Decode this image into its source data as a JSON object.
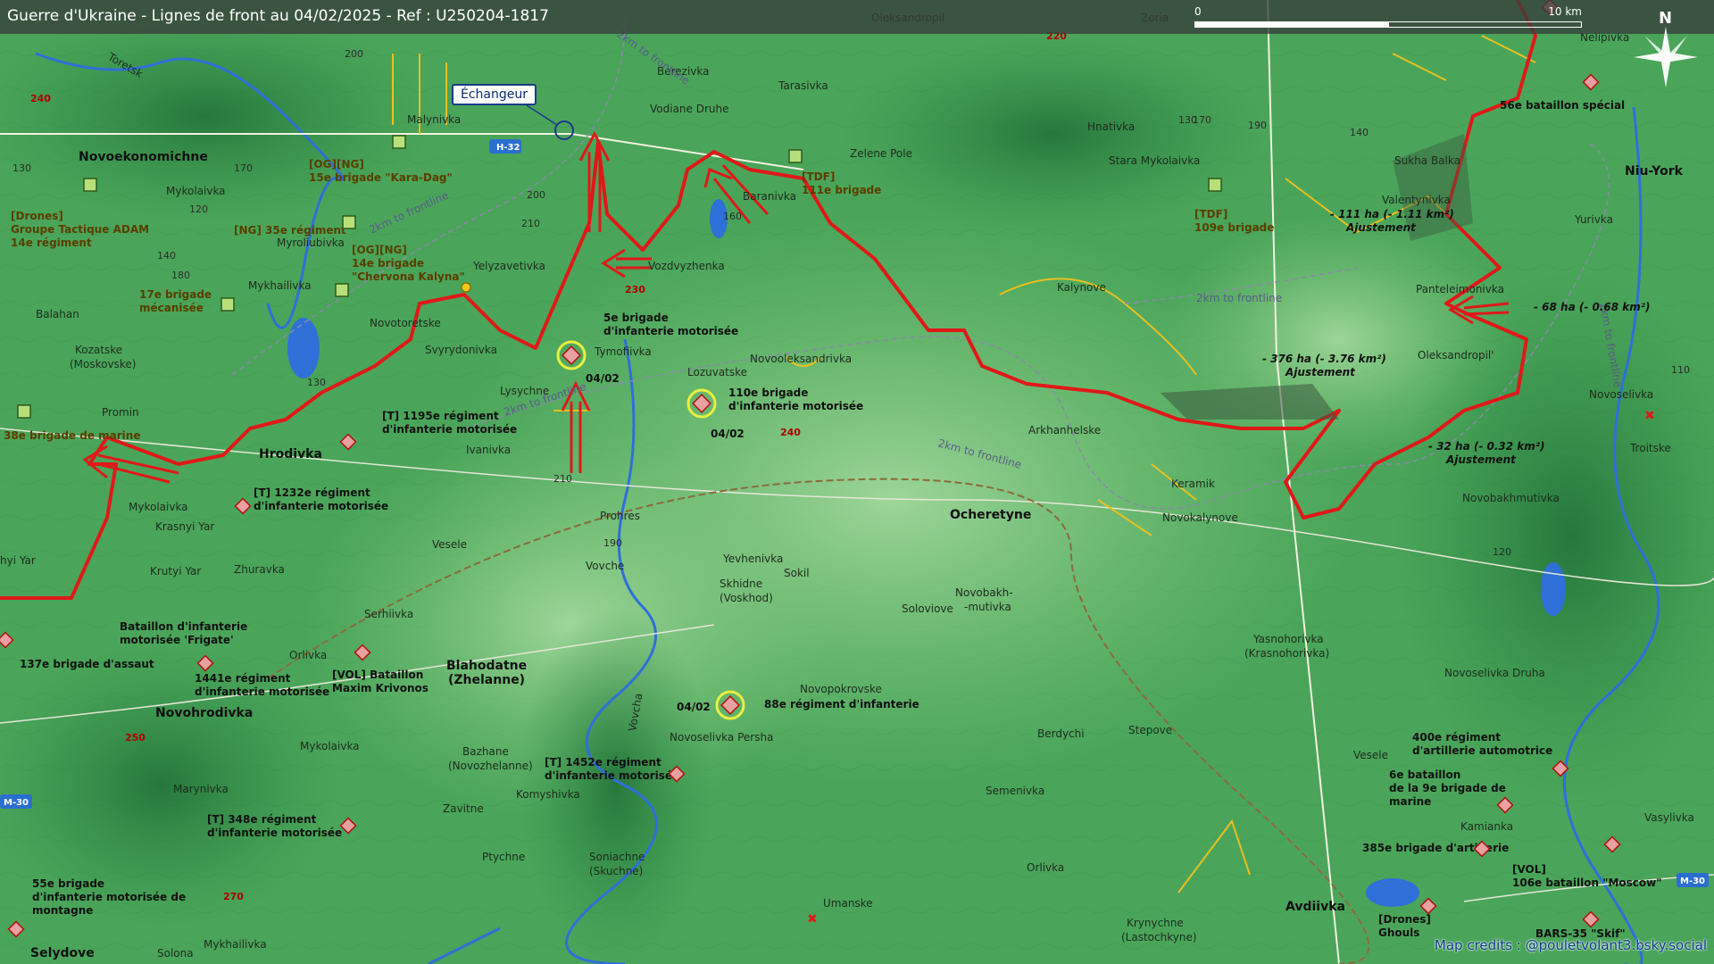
{
  "title": "Guerre d'Ukraine - Lignes de front au 04/02/2025 - Ref : U250204-1817",
  "scale": {
    "start": "0",
    "end": "10 km"
  },
  "compass": {
    "label": "N",
    "icon": "compass-rose-icon"
  },
  "credits": "Map credits : @pouletvolant3.bsky.social",
  "colors": {
    "front_line": "#e01818",
    "unit_marker": "#e8a0a0",
    "unit_marker_border": "#b01010",
    "friendly_marker": "#b8e07a",
    "highlight_ring": "#e8f040",
    "road_badge": "#2a6fd0",
    "river": "#2f6fd8",
    "yellow_trench": "#e8c020"
  },
  "callouts": {
    "echangeur": "Échangeur"
  },
  "towns": [
    "Novoekonomichne",
    "Hrodivka",
    "Novohrodivka",
    "Selydove",
    "Blahodatne",
    "(Zhelanne)",
    "Ocheretyne",
    "Avdiivka",
    "Niu-York"
  ],
  "places": [
    "Oleksandropil",
    "Zoria",
    "Nelipivka",
    "Malynivka",
    "Berezivka",
    "Vodiane Druhe",
    "Tarasivka",
    "Zelene Pole",
    "Hnativka",
    "Stara Mykolaivka",
    "Sukha Balka",
    "Mykolaivka",
    "Baranivka",
    "Valentynivka",
    "Yurivka",
    "Myroliubivka",
    "Yelyzavetivka",
    "Vozdvyzhenka",
    "Mykhailivka",
    "Kalynove",
    "Panteleimonivka",
    "Balahan",
    "Novotoretske",
    "Kozatske",
    "(Moskovske)",
    "Svyrydonivka",
    "Tymofiivka",
    "Lozuvatske",
    "Novooleksandrivka",
    "Oleksandropil'",
    "Novoselivka",
    "Lysychne",
    "Promin",
    "Arkhanhelske",
    "Ivanivka",
    "Troitske",
    "Keramik",
    "Novokalynove",
    "Mykolaivka",
    "Novobakhmutivka",
    "Krasnyi Yar",
    "Prohres",
    "Vesele",
    "Krutyi Yar",
    "Zhuravka",
    "Vovche",
    "Yevhenivka",
    "Sokil",
    "Skhidne",
    "(Voskhod)",
    "Novobakh-",
    "-mutivka",
    "Soloviove",
    "Serhiivka",
    "Orlivka",
    "Yasnohorivka",
    "(Krasnohorivka)",
    "Novoselivka Druha",
    "Novopokrovske",
    "Mykolaivka",
    "Bazhane",
    "(Novozhelanne)",
    "Novoselivka Persha",
    "Berdychi",
    "Stepove",
    "Marynivka",
    "Komyshivka",
    "Zavitne",
    "Semenivka",
    "Vesele",
    "Kamianka",
    "Vasylivka",
    "Ptychne",
    "Soniachne",
    "(Skuchne)",
    "Orlivka",
    "Umanske",
    "Krynychne",
    "(Lastochkyne)",
    "Mykhailivka",
    "Solona",
    "Vovcha",
    "hyi Yar",
    "Toretsk"
  ],
  "frontline_markers": [
    "2km to frontline",
    "2km to frontline",
    "2km to frontline",
    "2km to frontline",
    "2km to frontline",
    "2km to frontline"
  ],
  "units": {
    "og_kara_dag_tag": "[OG][NG]",
    "og_kara_dag": "15e brigade \"Kara-Dag\"",
    "tdf_111_tag": "[TDF]",
    "tdf_111": "111e brigade",
    "tdf_109_tag": "[TDF]",
    "tdf_109": "109e brigade",
    "drones_adam_tag": "[Drones]",
    "drones_adam_1": "Groupe Tactique ADAM",
    "drones_adam_2": "14e régiment",
    "ng_35": "[NG] 35e régiment",
    "og_14_tag": "[OG][NG]",
    "og_14_1": "14e brigade",
    "og_14_2": "\"Chervona Kalyna\"",
    "mech_17_1": "17e brigade",
    "mech_17_2": "mécanisée",
    "spec_56": "56e bataillon spécial",
    "mot_5_1": "5e brigade",
    "mot_5_2": "d'infanterie motorisée",
    "mot_110_1": "110e brigade",
    "mot_110_2": "d'infanterie motorisée",
    "marine_38": "38e brigade de marine",
    "t1195_1": "[T] 1195e régiment",
    "t1195_2": "d'infanterie motorisée",
    "t1232_1": "[T] 1232e régiment",
    "t1232_2": "d'infanterie motorisée",
    "frigate_1": "Bataillon d'infanterie",
    "frigate_2": "motorisée 'Frigate'",
    "assault_137": "137e brigade d'assaut",
    "r1441_1": "1441e régiment",
    "r1441_2": "d'infanterie motorisée",
    "krivonos_1": "[VOL] Bataillon",
    "krivonos_2": "Maxim Krivonos",
    "inf_88": "88e régiment d'infanterie",
    "t1452_1": "[T] 1452e régiment",
    "t1452_2": "d'infanterie motorisée",
    "t348_1": "[T] 348e régiment",
    "t348_2": "d'infanterie motorisée",
    "mtn_55_1": "55e brigade",
    "mtn_55_2": "d'infanterie motorisée de",
    "mtn_55_3": "montagne",
    "art_400_1": "400e régiment",
    "art_400_2": "d'artillerie automotrice",
    "mar9_1": "6e bataillon",
    "mar9_2": "de la 9e brigade de",
    "mar9_3": "marine",
    "art_385": "385e brigade d'artillerie",
    "moscow_tag": "[VOL]",
    "moscow": "106e bataillon \"Moscow\"",
    "ghouls_tag": "[Drones]",
    "ghouls": "Ghouls",
    "bars": "BARS-35 \"Skif\""
  },
  "dates": [
    "04/02",
    "04/02",
    "04/02"
  ],
  "adjustments": {
    "a111": "- 111 ha (- 1.11 km²)",
    "a111_label": "Ajustement",
    "a68": "- 68 ha (- 0.68 km²)",
    "a376": "- 376 ha (- 3.76 km²)",
    "a376_label": "Ajustement",
    "a32": "- 32 ha (- 0.32 km²)",
    "a32_label": "Ajustement"
  },
  "road_badges": [
    "H-32",
    "M-30",
    "M-30"
  ],
  "altitudes": [
    "200",
    "240",
    "170",
    "120",
    "130",
    "140",
    "160",
    "180",
    "200",
    "210",
    "220",
    "230",
    "240",
    "250",
    "270",
    "190",
    "130",
    "170",
    "190",
    "140",
    "110",
    "120",
    "130",
    "210"
  ]
}
